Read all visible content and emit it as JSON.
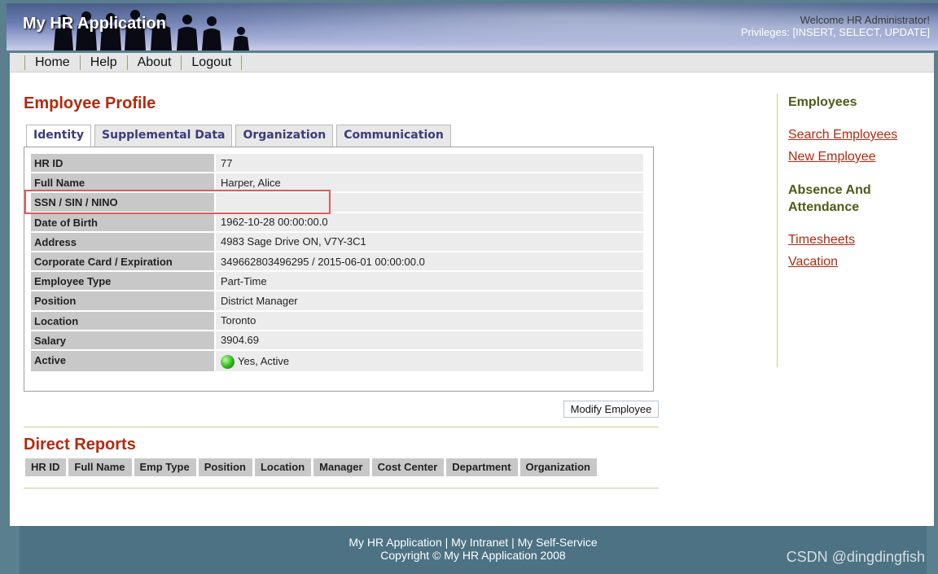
{
  "header": {
    "app_title": "My HR Application",
    "welcome": "Welcome HR Administrator!",
    "privileges": "Privileges: [INSERT, SELECT, UPDATE]"
  },
  "nav": [
    "Home",
    "Help",
    "About",
    "Logout"
  ],
  "page_title": "Employee Profile",
  "tabs": [
    "Identity",
    "Supplemental Data",
    "Organization",
    "Communication"
  ],
  "profile": [
    {
      "label": "HR ID",
      "value": "77"
    },
    {
      "label": "Full Name",
      "value": "Harper, Alice"
    },
    {
      "label": "SSN / SIN / NINO",
      "value": ""
    },
    {
      "label": "Date of Birth",
      "value": "1962-10-28 00:00:00.0"
    },
    {
      "label": "Address",
      "value": "4983 Sage Drive ON, V7Y-3C1"
    },
    {
      "label": "Corporate Card / Expiration",
      "value": "349662803496295 / 2015-06-01 00:00:00.0"
    },
    {
      "label": "Employee Type",
      "value": "Part-Time"
    },
    {
      "label": "Position",
      "value": "District Manager"
    },
    {
      "label": "Location",
      "value": "Toronto"
    },
    {
      "label": "Salary",
      "value": "3904.69"
    },
    {
      "label": "Active",
      "value": "Yes, Active"
    }
  ],
  "modify_button": "Modify Employee",
  "direct_reports": {
    "title": "Direct Reports",
    "columns": [
      "HR ID",
      "Full Name",
      "Emp Type",
      "Position",
      "Location",
      "Manager",
      "Cost Center",
      "Department",
      "Organization"
    ]
  },
  "sidebar": {
    "employees_heading": "Employees",
    "employees_links": [
      "Search Employees",
      "New Employee"
    ],
    "absence_heading": "Absence And Attendance",
    "absence_links": [
      "Timesheets",
      "Vacation"
    ]
  },
  "footer": {
    "links": "My HR Application | My Intranet | My Self-Service",
    "copyright": "Copyright © My HR Application 2008"
  },
  "watermark": "CSDN @dingdingfish",
  "colors": {
    "accent_red": "#b22a0f",
    "sidebar_heading": "#4f5b17",
    "tab_text": "#3c3c78",
    "highlight_box": "#e05a5a"
  }
}
